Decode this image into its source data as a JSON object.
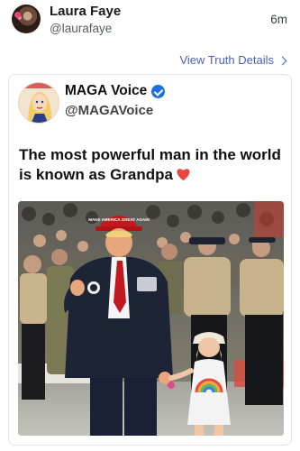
{
  "post": {
    "author_name": "Laura Faye",
    "author_handle": "@laurafaye",
    "time": "6m",
    "view_details": "View Truth Details"
  },
  "quote": {
    "author_name": "MAGA Voice",
    "author_handle": "@MAGAVoice",
    "text": "The most powerful man in the world is known as Grandpa",
    "hat_text": "MAKE AMERICA GREAT AGAIN"
  },
  "colors": {
    "link": "#4b5fb8",
    "verified": "#1d6fe0",
    "heart": "#e8473f",
    "tie": "#c0181f",
    "hat": "#c8161d"
  },
  "icons": {
    "verified": "verified-badge-icon",
    "chevron": "chevron-right-icon",
    "heart": "heart-emoji-icon"
  }
}
